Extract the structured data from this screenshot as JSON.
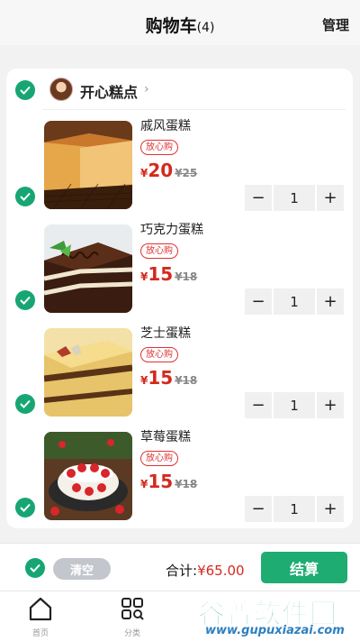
{
  "header": {
    "title": "购物车",
    "count": "(4)",
    "manage": "管理"
  },
  "shop": {
    "name": "开心糕点",
    "arrow": "›"
  },
  "items": [
    {
      "name": "戚风蛋糕",
      "tag": "放心购",
      "currency": "¥",
      "price": "20",
      "orig": "¥25",
      "qty": "1",
      "minus": "−",
      "plus": "+"
    },
    {
      "name": "巧克力蛋糕",
      "tag": "放心购",
      "currency": "¥",
      "price": "15",
      "orig": "¥18",
      "qty": "1",
      "minus": "−",
      "plus": "+"
    },
    {
      "name": "芝士蛋糕",
      "tag": "放心购",
      "currency": "¥",
      "price": "15",
      "orig": "¥18",
      "qty": "1",
      "minus": "−",
      "plus": "+"
    },
    {
      "name": "草莓蛋糕",
      "tag": "放心购",
      "currency": "¥",
      "price": "15",
      "orig": "¥18",
      "qty": "1",
      "minus": "−",
      "plus": "+"
    }
  ],
  "footer": {
    "clear": "清空",
    "total_label": "合计:",
    "total_value": "¥65.00",
    "checkout": "结算"
  },
  "tabs": [
    {
      "label": "首页",
      "icon": "home-icon"
    },
    {
      "label": "分类",
      "icon": "category-icon"
    }
  ],
  "watermark": {
    "main": "谷普软件园",
    "url": "www.gupuxiazai.com"
  },
  "colors": {
    "accent": "#1eac73",
    "check": "#17a673",
    "price": "#d32a1e"
  }
}
